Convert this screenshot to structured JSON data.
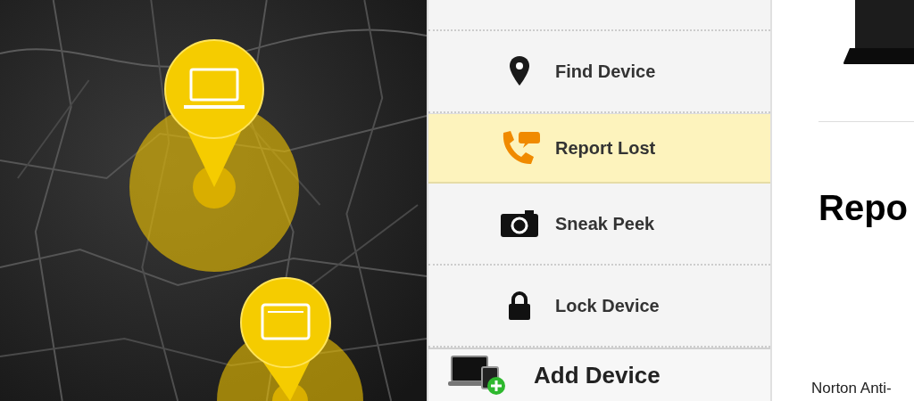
{
  "map": {
    "pins": [
      {
        "kind": "laptop"
      },
      {
        "kind": "tablet"
      }
    ]
  },
  "menu": {
    "items": [
      {
        "label": "Find Device",
        "kind": "find",
        "selected": false
      },
      {
        "label": "Report Lost",
        "kind": "report",
        "selected": true
      },
      {
        "label": "Sneak Peek",
        "kind": "peek",
        "selected": false
      },
      {
        "label": "Lock Device",
        "kind": "lock",
        "selected": false
      }
    ],
    "add_device": {
      "label": "Add Device"
    }
  },
  "content": {
    "heading": "Repo",
    "text": "Norton Anti-"
  }
}
